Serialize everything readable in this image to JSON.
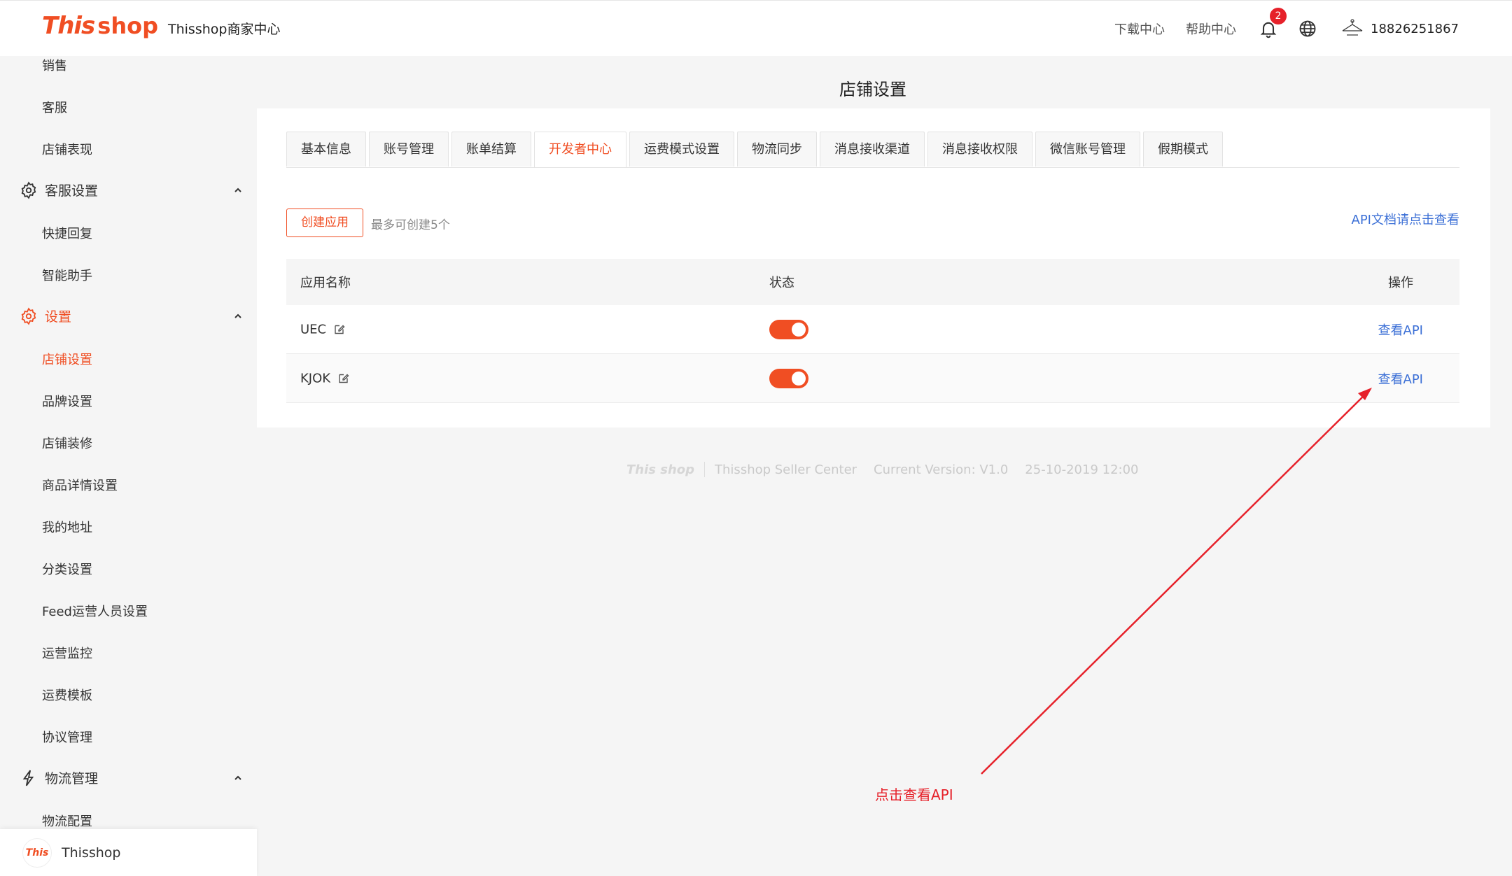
{
  "header": {
    "logo_this": "This",
    "logo_shop": "shop",
    "brand_title": "Thisshop商家中心",
    "download_center": "下载中心",
    "help_center": "帮助中心",
    "notification_count": "2",
    "username": "18826251867"
  },
  "sidebar": {
    "items_top": [
      {
        "label": "销售"
      },
      {
        "label": "客服"
      },
      {
        "label": "店铺表现"
      }
    ],
    "group_customer_service": {
      "label": "客服设置",
      "icon": "gear-icon"
    },
    "customer_service_items": [
      {
        "label": "快捷回复"
      },
      {
        "label": "智能助手"
      }
    ],
    "group_settings": {
      "label": "设置",
      "icon": "gear-icon"
    },
    "settings_items": [
      {
        "label": "店铺设置",
        "active": true
      },
      {
        "label": "品牌设置"
      },
      {
        "label": "店铺装修"
      },
      {
        "label": "商品详情设置"
      },
      {
        "label": "我的地址"
      },
      {
        "label": "分类设置"
      },
      {
        "label": "Feed运营人员设置"
      },
      {
        "label": "运营监控"
      },
      {
        "label": "运费模板"
      },
      {
        "label": "协议管理"
      }
    ],
    "group_logistics": {
      "label": "物流管理",
      "icon": "lightning-icon"
    },
    "logistics_items": [
      {
        "label": "物流配置"
      }
    ],
    "footer_label": "Thisshop",
    "footer_logo_text": "This"
  },
  "main": {
    "page_title": "店铺设置",
    "tabs": [
      {
        "label": "基本信息"
      },
      {
        "label": "账号管理"
      },
      {
        "label": "账单结算"
      },
      {
        "label": "开发者中心",
        "active": true
      },
      {
        "label": "运费模式设置"
      },
      {
        "label": "物流同步"
      },
      {
        "label": "消息接收渠道"
      },
      {
        "label": "消息接收权限"
      },
      {
        "label": "微信账号管理"
      },
      {
        "label": "假期模式"
      }
    ],
    "create_button": "创建应用",
    "create_hint": "最多可创建5个",
    "api_doc_link": "API文档请点击查看",
    "table": {
      "headers": {
        "name": "应用名称",
        "status": "状态",
        "action": "操作"
      },
      "rows": [
        {
          "name": "UEC",
          "status_on": true,
          "action": "查看API"
        },
        {
          "name": "KJOK",
          "status_on": true,
          "action": "查看API"
        }
      ]
    }
  },
  "footer": {
    "logo": "This shop",
    "product": "Thisshop Seller Center",
    "version": "Current Version: V1.0",
    "date": "25-10-2019 12:00"
  },
  "annotation": {
    "text": "点击查看API",
    "color": "#e6212a"
  },
  "colors": {
    "brand": "#f04e23",
    "link": "#3b6fd6"
  }
}
